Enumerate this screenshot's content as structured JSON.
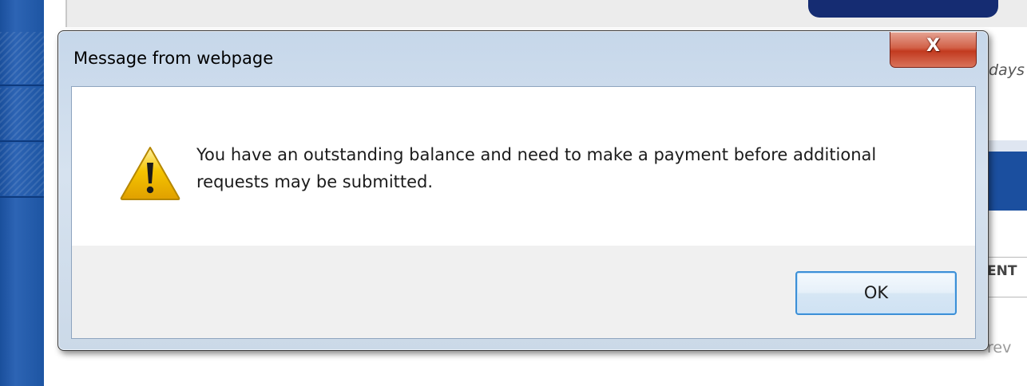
{
  "dialog": {
    "title": "Message from webpage",
    "close_glyph": "X",
    "message": "You have an outstanding balance and need to make a payment before additional requests may be submitted.",
    "icon": "warning-icon",
    "ok_label": "OK"
  },
  "background_page": {
    "right_edge_text_1": "days",
    "right_edge_text_2": "ENT",
    "right_edge_text_3": "rev"
  },
  "colors": {
    "page_nav_blue": "#1d55a3",
    "top_button_navy": "#152c72",
    "dialog_frame": "#cbd9e8",
    "close_button_red": "#c23a1f",
    "ok_button_border": "#3c8fd6",
    "warning_yellow": "#f5c400"
  }
}
